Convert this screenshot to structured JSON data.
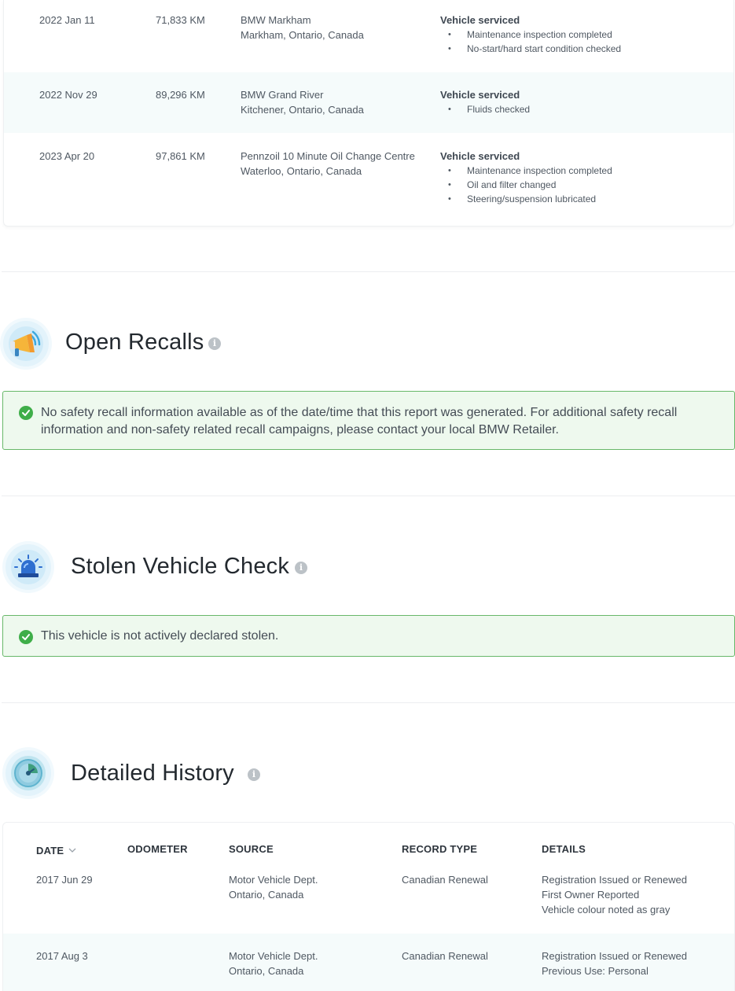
{
  "service_rows": [
    {
      "date": "2022 Jan 11",
      "odometer": "71,833 KM",
      "source_line1": "BMW Markham",
      "source_line2": "Markham, Ontario, Canada",
      "detail_title": "Vehicle serviced",
      "detail_items": [
        "Maintenance inspection completed",
        "No-start/hard start condition checked"
      ]
    },
    {
      "date": "2022 Nov 29",
      "odometer": "89,296 KM",
      "source_line1": "BMW Grand River",
      "source_line2": "Kitchener, Ontario, Canada",
      "detail_title": "Vehicle serviced",
      "detail_items": [
        "Fluids checked"
      ]
    },
    {
      "date": "2023 Apr 20",
      "odometer": "97,861 KM",
      "source_line1": "Pennzoil 10 Minute Oil Change Centre",
      "source_line2": "Waterloo, Ontario, Canada",
      "detail_title": "Vehicle serviced",
      "detail_items": [
        "Maintenance inspection completed",
        "Oil and filter changed",
        "Steering/suspension lubricated"
      ]
    }
  ],
  "recalls": {
    "title": "Open Recalls",
    "icon": "megaphone-icon",
    "message": "No safety recall information available as of the date/time that this report was generated. For additional safety recall information and non-safety related recall campaigns, please contact your local BMW Retailer."
  },
  "stolen": {
    "title": "Stolen Vehicle Check",
    "icon": "siren-icon",
    "message": "This vehicle is not actively declared stolen."
  },
  "history": {
    "title": "Detailed History",
    "icon": "clock-icon",
    "columns": {
      "date": "DATE",
      "odometer": "ODOMETER",
      "source": "SOURCE",
      "record_type": "RECORD TYPE",
      "details": "DETAILS"
    },
    "rows": [
      {
        "date": "2017 Jun 29",
        "odometer": "",
        "source_line1": "Motor Vehicle Dept.",
        "source_line2": "Ontario, Canada",
        "record_type": "Canadian Renewal",
        "details": [
          "Registration Issued or Renewed",
          "First Owner Reported",
          "Vehicle colour noted as gray"
        ]
      },
      {
        "date": "2017 Aug 3",
        "odometer": "",
        "source_line1": "Motor Vehicle Dept.",
        "source_line2": "Ontario, Canada",
        "record_type": "Canadian Renewal",
        "details": [
          "Registration Issued or Renewed",
          "Previous Use: Personal"
        ]
      }
    ]
  },
  "colors": {
    "success_green": "#3fae49",
    "alert_bg": "#eef9ee",
    "alert_border": "#68b86a",
    "row_alt": "#f5fbfb"
  }
}
